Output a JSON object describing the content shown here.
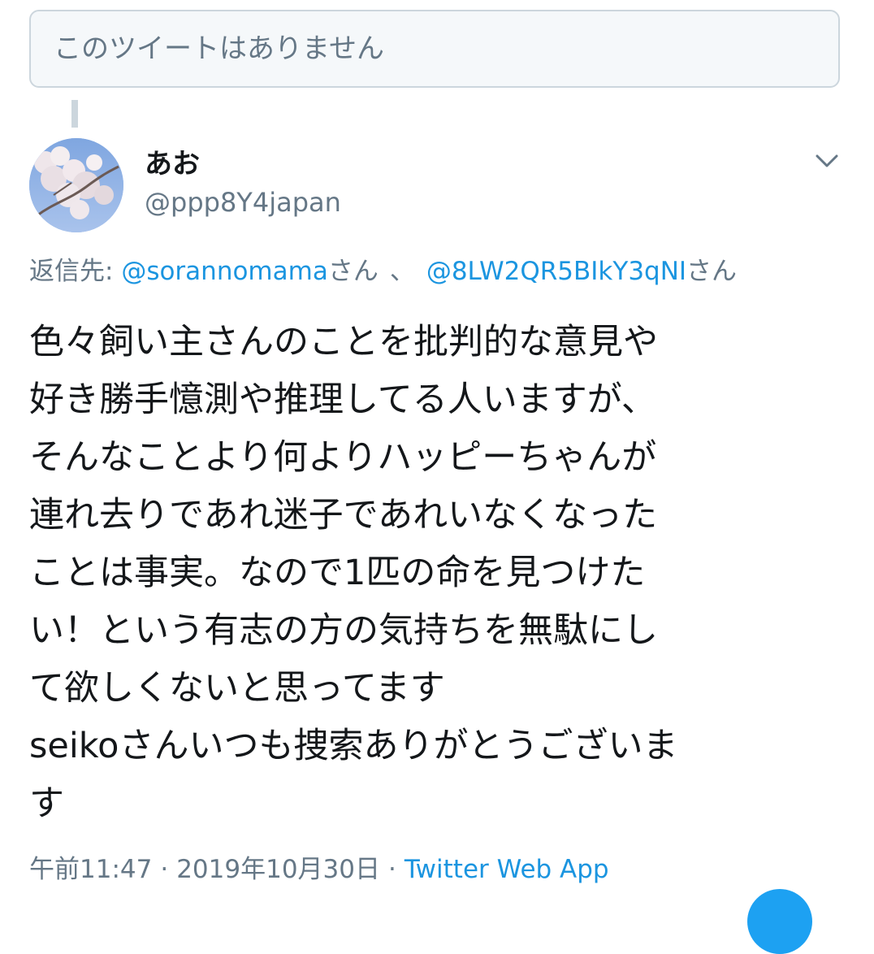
{
  "unavailable_tweet": {
    "text": "このツイートはありません"
  },
  "tweet": {
    "avatar_icon": "profile-photo-cherry-blossom",
    "display_name": "あお",
    "handle": "@ppp8Y4japan",
    "menu_icon": "chevron-down-icon",
    "replying_to": {
      "label": "返信先:",
      "users": [
        {
          "handle": "@sorannomama",
          "suffix": "さん"
        },
        {
          "handle": "@8LW2QR5BIkY3qNI",
          "suffix": "さん"
        }
      ],
      "separator": "、"
    },
    "body_lines": [
      "色々飼い主さんのことを批判的な意見や",
      "好き勝手憶測や推理してる人いますが、",
      "そんなことより何よりハッピーちゃんが",
      "連れ去りであれ迷子であれいなくなった",
      "ことは事実。なので1匹の命を見つけた",
      "い！という有志の方の気持ちを無駄にし",
      "て欲しくないと思ってます",
      "seikoさんいつも捜索ありがとうございま",
      "す"
    ],
    "time": "午前11:47",
    "date": "2019年10月30日",
    "dot": "·",
    "source": "Twitter Web App"
  },
  "colors": {
    "link": "#1b95e0",
    "secondary_text": "#657786",
    "primary_text": "#14171a",
    "border": "#ccd6dd",
    "fab": "#1da1f2"
  }
}
